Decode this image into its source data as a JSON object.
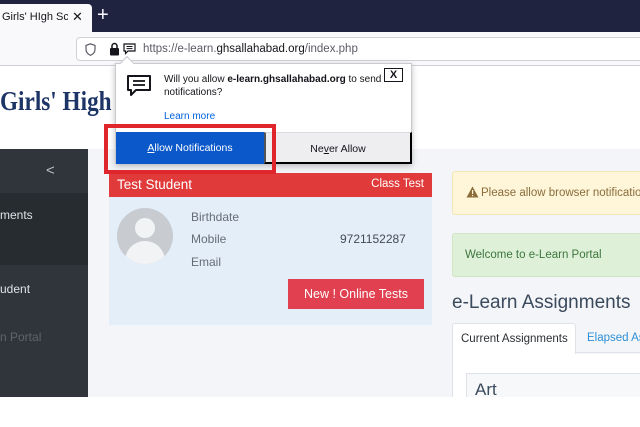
{
  "browser": {
    "tab_title": "Girls' HIgh Scho",
    "new_tab_symbol": "+",
    "close_symbol": "✕",
    "url_prefix": "https://e-learn.",
    "url_domain": "ghsallahabad.org",
    "url_suffix": "/index.php"
  },
  "popup": {
    "message_prefix": "Will you allow ",
    "site": "e-learn.ghsallahabad.org",
    "message_suffix": " to send notifications?",
    "learn_more": "Learn more",
    "close_symbol": "X",
    "allow_first": "A",
    "allow_rest": "llow Notifications",
    "never_first": "Ne",
    "never_underlined": "v",
    "never_rest": "er Allow"
  },
  "site": {
    "brand": "Girls' High Sch"
  },
  "sidebar": {
    "collapse_symbol": "<",
    "items": [
      {
        "label": "ments"
      },
      {
        "label": "udent"
      },
      {
        "label": "n Portal"
      }
    ]
  },
  "student_card": {
    "name": "Test Student",
    "tag": "Class Test",
    "fields": [
      {
        "label": "Birthdate",
        "value": ""
      },
      {
        "label": "Mobile",
        "value": "9721152287"
      },
      {
        "label": "Email",
        "value": ""
      }
    ],
    "button": "New ! Online Tests"
  },
  "alerts": {
    "warning": "Please allow browser notifications",
    "welcome": "Welcome to e-Learn Portal"
  },
  "assignments": {
    "title": "e-Learn Assignments",
    "tabs": [
      "Current Assignments",
      "Elapsed Assignments"
    ],
    "first_subject": "Art"
  },
  "colors": {
    "tab_bar": "#202340",
    "brand": "#1d3466",
    "card_header": "#e03a3a",
    "allow_button": "#0a58c9",
    "highlight_box": "#e0262d",
    "online_tests_button": "#e0404f"
  }
}
